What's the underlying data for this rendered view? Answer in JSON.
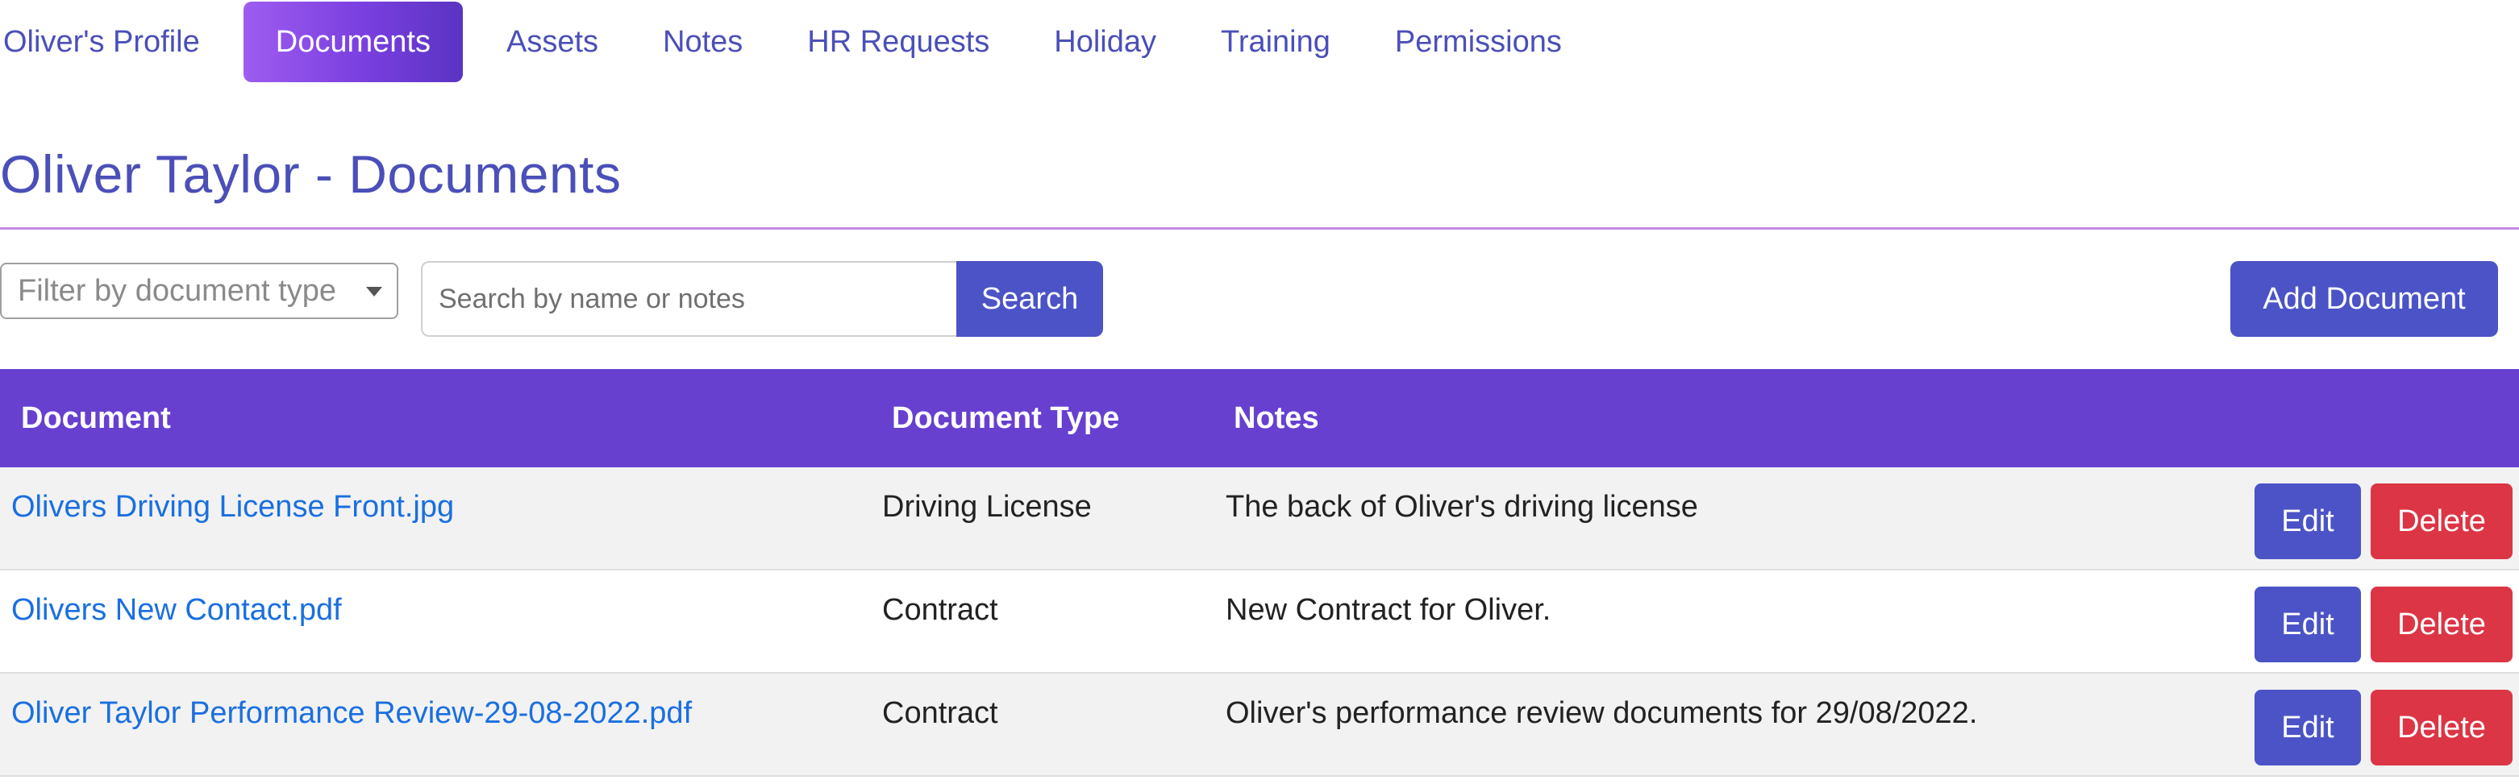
{
  "nav": {
    "items": [
      {
        "label": "Oliver's Profile",
        "active": false
      },
      {
        "label": "Documents",
        "active": true
      },
      {
        "label": "Assets",
        "active": false
      },
      {
        "label": "Notes",
        "active": false
      },
      {
        "label": "HR Requests",
        "active": false
      },
      {
        "label": "Holiday",
        "active": false
      },
      {
        "label": "Training",
        "active": false
      },
      {
        "label": "Permissions",
        "active": false
      }
    ]
  },
  "page": {
    "title": "Oliver Taylor - Documents"
  },
  "toolbar": {
    "filter_placeholder": "Filter by document type",
    "search_placeholder": "Search by name or notes",
    "search_label": "Search",
    "add_label": "Add Document"
  },
  "table": {
    "headers": {
      "document": "Document",
      "type": "Document Type",
      "notes": "Notes"
    },
    "rows": [
      {
        "document": "Olivers Driving License Front.jpg",
        "type": "Driving License",
        "notes": "The back of Oliver's driving license",
        "edit": "Edit",
        "delete": "Delete"
      },
      {
        "document": "Olivers New Contact.pdf",
        "type": "Contract",
        "notes": "New Contract for Oliver.",
        "edit": "Edit",
        "delete": "Delete"
      },
      {
        "document": "Oliver Taylor Performance Review-29-08-2022.pdf",
        "type": "Contract",
        "notes": "Oliver's performance review documents for 29/08/2022.",
        "edit": "Edit",
        "delete": "Delete"
      }
    ]
  },
  "colors": {
    "accent": "#4b53c6",
    "header_bg": "#6740d0",
    "danger": "#dc3545",
    "link": "#1a6fe0",
    "nav_text": "#4b4fb8"
  }
}
